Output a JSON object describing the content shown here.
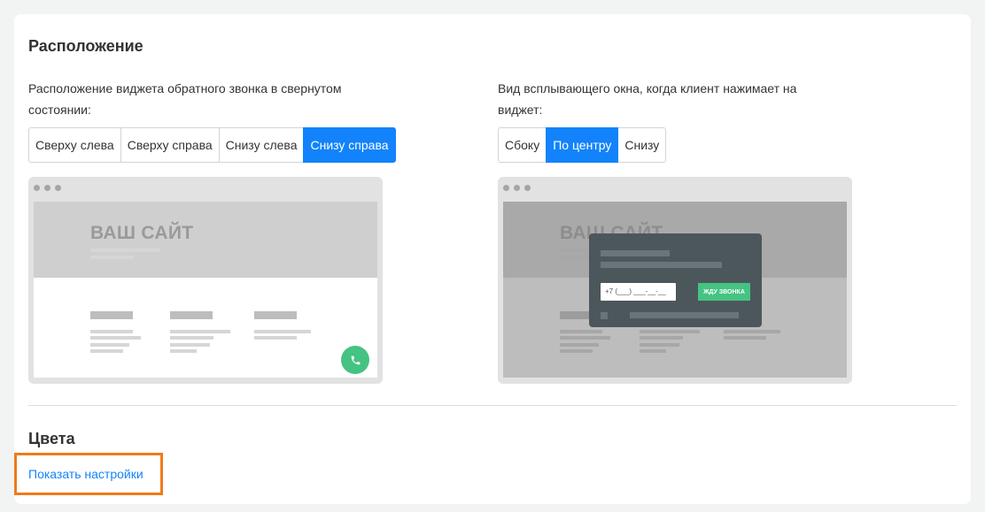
{
  "placement_section": {
    "title": "Расположение",
    "collapsed_label": "Расположение виджета обратного звонка в свернутом состоянии:",
    "collapsed_options": [
      "Сверху слева",
      "Сверху справа",
      "Снизу слева",
      "Снизу справа"
    ],
    "collapsed_selected": "Снизу справа",
    "popup_label": "Вид всплывающего окна, когда клиент нажимает на виджет:",
    "popup_options": [
      "Сбоку",
      "По центру",
      "Снизу"
    ],
    "popup_selected": "По центру"
  },
  "preview_left": {
    "site_title": "ВАШ САЙТ",
    "icons": {
      "call_button": "phone-icon"
    }
  },
  "preview_right": {
    "site_title": "ВАШ САЙТ",
    "phone_placeholder": "+7 (___) ___-__-__",
    "wait_button_label": "ЖДУ ЗВОНКА"
  },
  "colors_section": {
    "title": "Цвета",
    "show_settings_label": "Показать настройки"
  },
  "colors": {
    "accent": "#1283fb",
    "widget_green": "#45c382",
    "highlight_outline": "#f07a1a",
    "popup_bg": "#4c575c"
  }
}
